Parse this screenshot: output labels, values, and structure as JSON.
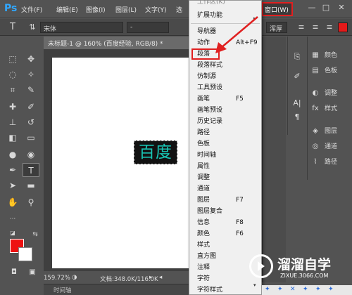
{
  "app": {
    "logo": "Ps"
  },
  "menubar": {
    "items": [
      "文件(F)",
      "编辑(E)",
      "图像(I)",
      "图层(L)",
      "文字(Y)",
      "选"
    ],
    "window_menu": "窗口(W)",
    "controls": [
      "—",
      "□",
      "✕"
    ]
  },
  "options": {
    "font_family": "宋体",
    "font_style": "-",
    "antialias": "浑厚"
  },
  "document": {
    "tab_title": "未标题-1 @ 160% (百度经验, RGB/8) *",
    "text_layer": "百度",
    "zoom": "159.72%",
    "doc_info": "文档:348.0K/116.0K",
    "timeline": "时间轴"
  },
  "dropdown": {
    "items": [
      {
        "label": "工作区(K)",
        "shortcut": ""
      },
      {
        "label": "扩展功能",
        "shortcut": ""
      },
      {
        "label": "导航器",
        "shortcut": ""
      },
      {
        "label": "动作",
        "shortcut": "Alt+F9"
      },
      {
        "label": "段落",
        "shortcut": ""
      },
      {
        "label": "段落样式",
        "shortcut": ""
      },
      {
        "label": "仿制源",
        "shortcut": ""
      },
      {
        "label": "工具预设",
        "shortcut": ""
      },
      {
        "label": "画笔",
        "shortcut": "F5"
      },
      {
        "label": "画笔预设",
        "shortcut": ""
      },
      {
        "label": "历史记录",
        "shortcut": ""
      },
      {
        "label": "路径",
        "shortcut": ""
      },
      {
        "label": "色板",
        "shortcut": ""
      },
      {
        "label": "时间轴",
        "shortcut": ""
      },
      {
        "label": "属性",
        "shortcut": ""
      },
      {
        "label": "调整",
        "shortcut": ""
      },
      {
        "label": "通道",
        "shortcut": ""
      },
      {
        "label": "图层",
        "shortcut": "F7"
      },
      {
        "label": "图层复合",
        "shortcut": ""
      },
      {
        "label": "信息",
        "shortcut": "F8"
      },
      {
        "label": "颜色",
        "shortcut": "F6"
      },
      {
        "label": "样式",
        "shortcut": ""
      },
      {
        "label": "直方图",
        "shortcut": ""
      },
      {
        "label": "注释",
        "shortcut": ""
      },
      {
        "label": "字符",
        "shortcut": ""
      },
      {
        "label": "字符样式",
        "shortcut": ""
      }
    ]
  },
  "panels": {
    "items": [
      "颜色",
      "色板",
      "调整",
      "样式",
      "图层",
      "通道",
      "路径"
    ]
  },
  "watermark": {
    "title": "溜溜自学",
    "url": "ZIXUE.3066.COM"
  },
  "colors": {
    "foreground": "#ee1111",
    "background": "#ffffff",
    "highlight": "#e02020"
  }
}
